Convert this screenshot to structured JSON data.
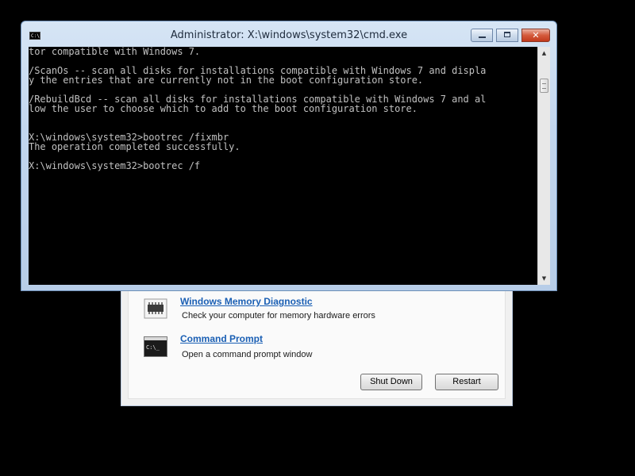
{
  "window": {
    "title": "Administrator: X:\\windows\\system32\\cmd.exe",
    "icon_label": "C:\\",
    "buttons": {
      "minimize": "minimize-icon",
      "maximize": "maximize-icon",
      "close": "✕"
    }
  },
  "console": {
    "lines": [
      "tor compatible with Windows 7.",
      "",
      "/ScanOs -- scan all disks for installations compatible with Windows 7 and displa",
      "y the entries that are currently not in the boot configuration store.",
      "",
      "/RebuildBcd -- scan all disks for installations compatible with Windows 7 and al",
      "low the user to choose which to add to the boot configuration store.",
      "",
      "",
      "X:\\windows\\system32>bootrec /fixmbr",
      "The operation completed successfully.",
      "",
      "X:\\windows\\system32>bootrec /f"
    ],
    "text_color": "#c0c0c0",
    "background": "#000000"
  },
  "scrollbar": {
    "up_arrow": "▲",
    "down_arrow": "▼"
  },
  "recovery": {
    "options": [
      {
        "title": "Windows Memory Diagnostic",
        "description": "Check your computer for memory hardware errors",
        "icon": "memory-chip-icon"
      },
      {
        "title": "Command Prompt",
        "description": "Open a command prompt window",
        "icon": "command-prompt-icon",
        "icon_text": "C:\\_"
      }
    ],
    "buttons": {
      "shutdown": "Shut Down",
      "restart": "Restart"
    },
    "link_color": "#1a5fb4"
  }
}
